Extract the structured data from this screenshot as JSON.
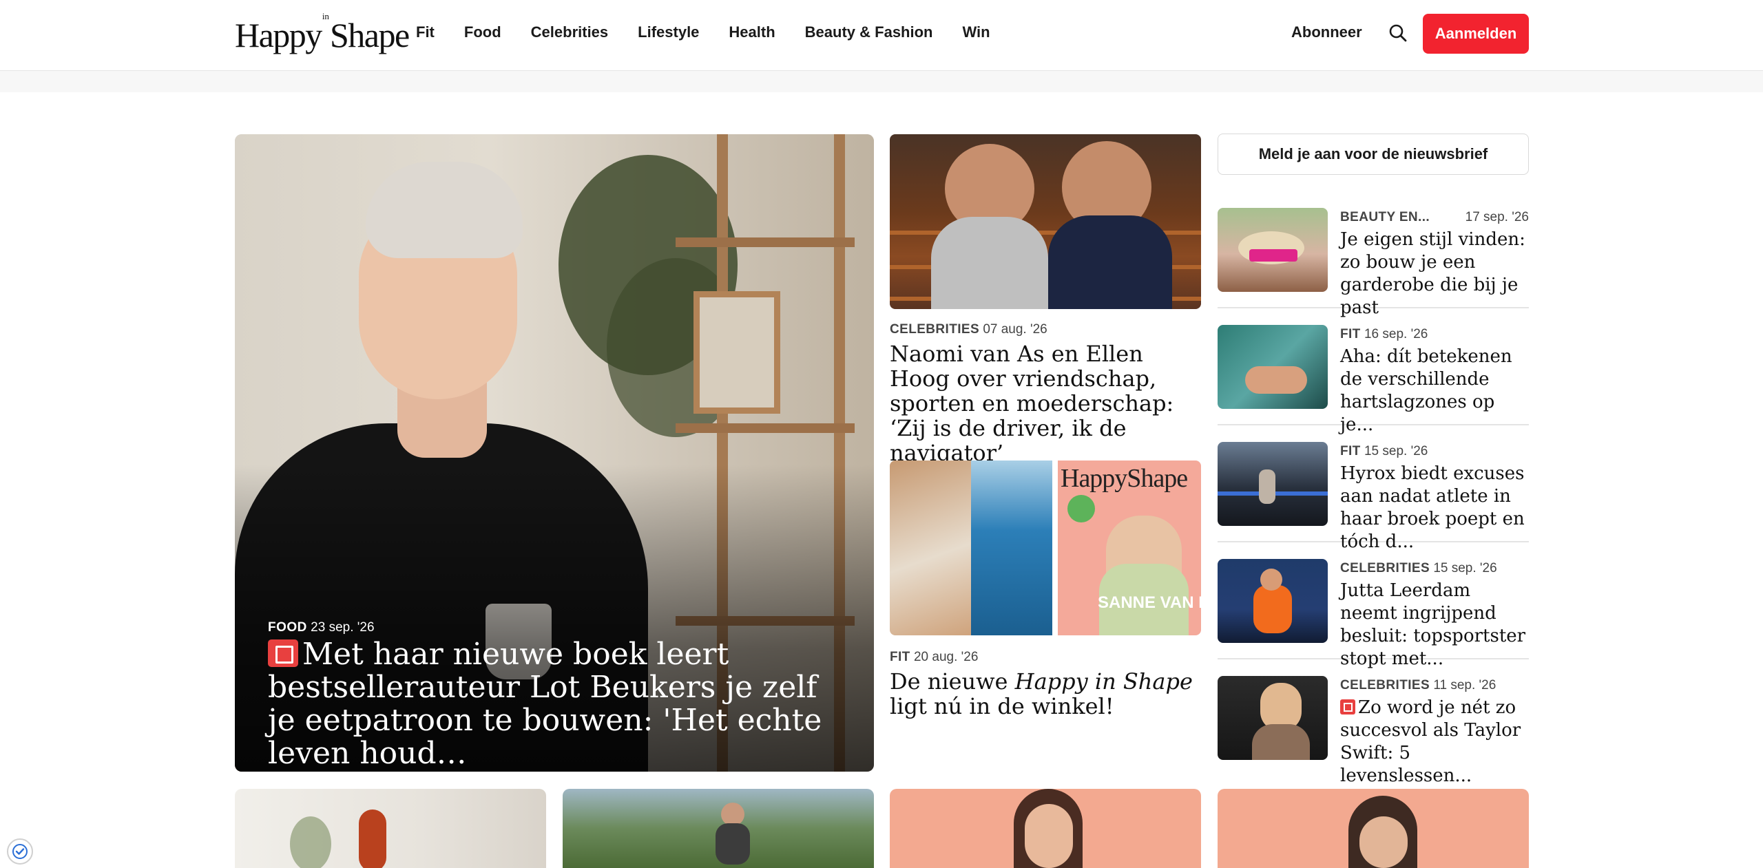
{
  "header": {
    "logo_left": "Happy",
    "logo_sup": "in",
    "logo_right": "Shape",
    "nav": [
      "Fit",
      "Food",
      "Celebrities",
      "Lifestyle",
      "Health",
      "Beauty & Fashion",
      "Win"
    ],
    "subscribe_label": "Abonneer",
    "login_label": "Aanmelden"
  },
  "hero": {
    "category": "FOOD",
    "date": "23 sep. '26",
    "title": "Met haar nieuwe boek leert bestsel­lerauteur Lot Beukers je zelf je eetpa­troon te bouwen: 'Het echte leven houd…",
    "premium_icon": "premium-book-icon"
  },
  "middle": [
    {
      "category": "CELEBRITIES",
      "date": "07 aug. '26",
      "title": "Naomi van As en Ellen Hoog over vriendschap, sporten en moederschap: ‘Zij is de driver, ik de navigator’"
    },
    {
      "category": "FIT",
      "date": "20 aug. '26",
      "title_before": "De nieuwe ",
      "title_italic": "Happy in Shape",
      "title_after": " ligt nú in de winkel!",
      "cover_logo": "HappyShape",
      "cover_name": "SANNE VAN LIEROP"
    }
  ],
  "sidebar": {
    "newsletter_label": "Meld je aan voor de nieuwsbrief",
    "items": [
      {
        "category": "BEAUTY EN...",
        "date": "17 sep. '26",
        "title": "Je eigen stijl vinden: zo bouw je een garderobe die bij je past"
      },
      {
        "category": "FIT",
        "date": "16 sep. '26",
        "title": "Aha: dít betekenen de verschillende hartslag­zones op je..."
      },
      {
        "category": "FIT",
        "date": "15 sep. '26",
        "title": "Hyrox biedt excuses aan nadat atlete in haar broek poept en tóch d..."
      },
      {
        "category": "CELEBRITIES",
        "date": "15 sep. '26",
        "title": "Jutta Leerdam neemt ingrijpend besluit: top­sportster stopt met..."
      },
      {
        "category": "CELEBRITIES",
        "date": "11 sep. '26",
        "title": "Zo word je nét zo succesvol als Taylor Swift: 5 levenslessen..."
      }
    ]
  },
  "colors": {
    "accent": "#f2232f",
    "premium_badge": "#e8403f"
  }
}
